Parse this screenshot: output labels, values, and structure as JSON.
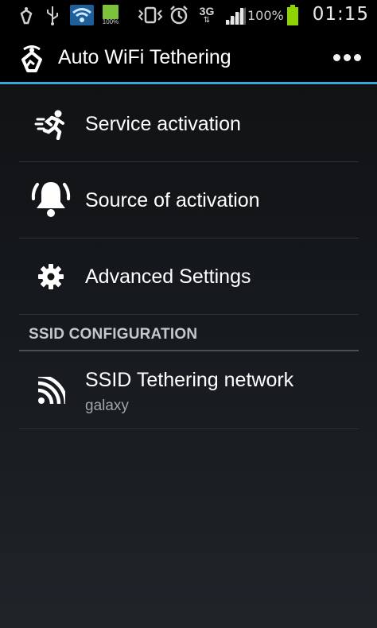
{
  "status_bar": {
    "icons": [
      "tethering-icon",
      "usb-icon",
      "wifi-hotspot-icon",
      "battery-charged-icon",
      "vibrate-icon",
      "alarm-icon",
      "3g-data-icon",
      "signal-icon",
      "battery-icon"
    ],
    "small_battery_text": "100%",
    "network_type": "3G",
    "battery_percent": "100%",
    "time": "01:15"
  },
  "action_bar": {
    "title": "Auto WiFi Tethering",
    "menu_icon": "overflow-menu-icon"
  },
  "menu_items": [
    {
      "label": "Service activation",
      "icon": "running-man-icon"
    },
    {
      "label": "Source of activation",
      "icon": "bell-icon"
    },
    {
      "label": "Advanced Settings",
      "icon": "gear-icon"
    }
  ],
  "ssid_section": {
    "header": "SSID CONFIGURATION",
    "item": {
      "label": "SSID Tethering network",
      "summary": "galaxy",
      "icon": "rss-signal-icon"
    }
  },
  "colors": {
    "accent": "#36a6d8",
    "battery": "#8fd400"
  }
}
